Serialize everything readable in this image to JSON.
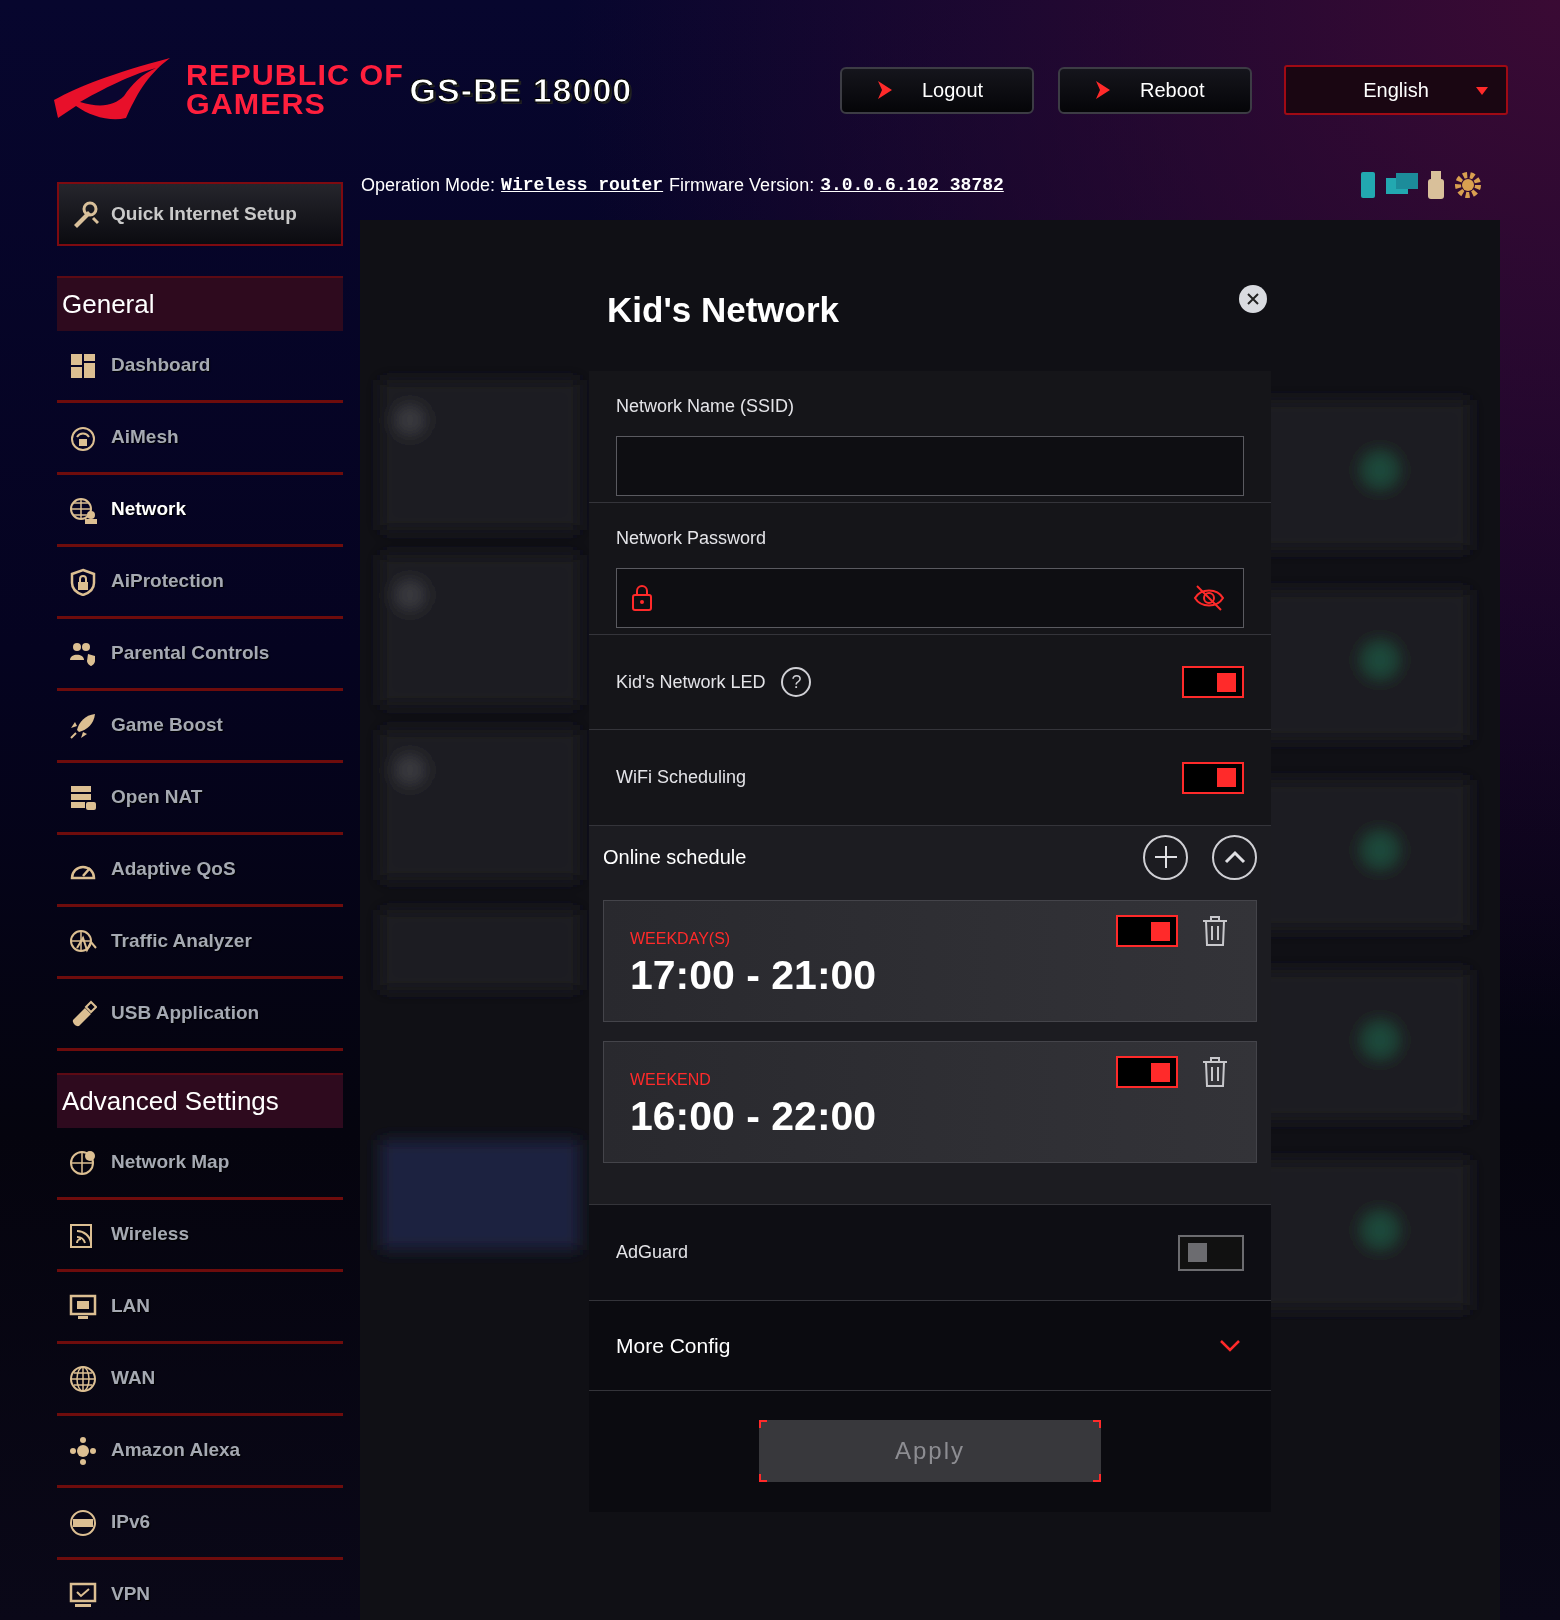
{
  "header": {
    "brand_lines": [
      "REPUBLIC OF",
      "GAMERS"
    ],
    "model": "GS-BE 18000",
    "buttons": [
      "Logout",
      "Reboot"
    ],
    "language": "English"
  },
  "info": {
    "mode_label": "Operation Mode:",
    "mode": "Wireless router",
    "firmware_label": "Firmware Version:",
    "firmware": "3.0.0.6.102_38782"
  },
  "sidebar": {
    "quick_setup": "Quick Internet Setup",
    "sections": [
      {
        "title": "General",
        "items": [
          {
            "label": "Dashboard",
            "selected": false
          },
          {
            "label": "AiMesh",
            "selected": false
          },
          {
            "label": "Network",
            "selected": true
          },
          {
            "label": "AiProtection",
            "selected": false
          },
          {
            "label": "Parental Controls",
            "selected": false
          },
          {
            "label": "Game Boost",
            "selected": false
          },
          {
            "label": "Open NAT",
            "selected": false
          },
          {
            "label": "Adaptive QoS",
            "selected": false
          },
          {
            "label": "Traffic Analyzer",
            "selected": false
          },
          {
            "label": "USB Application",
            "selected": false
          }
        ]
      },
      {
        "title": "Advanced Settings",
        "items": [
          {
            "label": "Network Map",
            "selected": false
          },
          {
            "label": "Wireless",
            "selected": false
          },
          {
            "label": "LAN",
            "selected": false
          },
          {
            "label": "WAN",
            "selected": false
          },
          {
            "label": "Amazon Alexa",
            "selected": false
          },
          {
            "label": "IPv6",
            "selected": false
          },
          {
            "label": "VPN",
            "selected": false
          }
        ]
      }
    ]
  },
  "modal": {
    "title": "Kid's Network",
    "rows": [
      {
        "kind": "text_field",
        "label": "Network Name (SSID)"
      },
      {
        "kind": "password_field",
        "label": "Network Password"
      },
      {
        "kind": "toggle",
        "label": "Kid's Network LED",
        "help": "?",
        "on": true
      },
      {
        "kind": "toggle",
        "label": "WiFi Scheduling",
        "on": true
      }
    ],
    "schedule": {
      "title": "Online schedule",
      "expanded": true,
      "entries": [
        {
          "days": "WEEKDAY(S)",
          "time": "17:00 - 21:00",
          "on": true
        },
        {
          "days": "WEEKEND",
          "time": "16:00 - 22:00",
          "on": true
        }
      ]
    },
    "adguard": {
      "label": "AdGuard",
      "on": false
    },
    "more_config": {
      "label": "More Config",
      "expanded": false
    },
    "apply": {
      "label": "Apply",
      "disabled": true
    }
  }
}
